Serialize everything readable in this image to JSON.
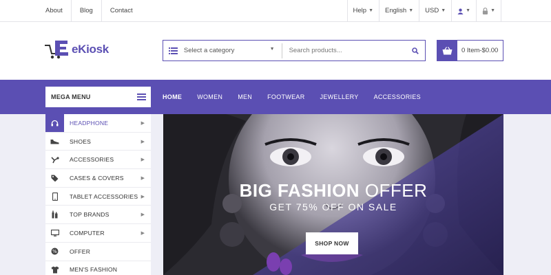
{
  "topbar": {
    "links": [
      "About",
      "Blog",
      "Contact"
    ],
    "help": "Help",
    "language": "English",
    "currency": "USD"
  },
  "header": {
    "logo_text": "eKiosk",
    "search": {
      "category_placeholder": "Select a category",
      "placeholder": "Search products..."
    },
    "cart": {
      "summary": "0 Item-$0.00"
    }
  },
  "nav": {
    "mega_menu_label": "MEGA MENU",
    "links": [
      "HOME",
      "WOMEN",
      "MEN",
      "FOOTWEAR",
      "JEWELLERY",
      "ACCESSORIES"
    ],
    "active_link": "HOME"
  },
  "sidebar": {
    "items": [
      {
        "label": "HEADPHONE",
        "icon": "headphone-icon",
        "active": true
      },
      {
        "label": "SHOES",
        "icon": "shoe-icon"
      },
      {
        "label": "ACCESSORIES",
        "icon": "accessories-icon"
      },
      {
        "label": "CASES & COVERS",
        "icon": "tag-icon"
      },
      {
        "label": "TABLET ACCESSORIES",
        "icon": "tablet-icon"
      },
      {
        "label": "TOP BRANDS",
        "icon": "bottles-icon"
      },
      {
        "label": "COMPUTER",
        "icon": "monitor-icon"
      },
      {
        "label": "OFFER",
        "icon": "offer-icon"
      },
      {
        "label": "MEN'S FASHION",
        "icon": "shirt-icon"
      }
    ]
  },
  "banner": {
    "title_bold": "BIG FASHION",
    "title_light": "OFFER",
    "subtitle": "GET 75% OFF ON SALE",
    "cta": "SHOP NOW"
  },
  "colors": {
    "brand": "#5b4fb3",
    "background": "#eeeef6"
  }
}
